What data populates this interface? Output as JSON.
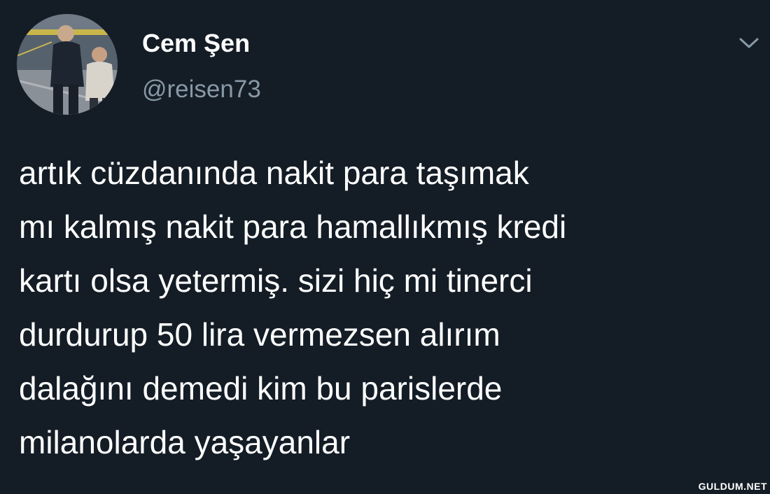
{
  "tweet": {
    "author": {
      "display_name": "Cem Şen",
      "handle": "@reisen73",
      "avatar": "profile-photo"
    },
    "menu_icon": "chevron-down-icon",
    "text": "artık cüzdanında nakit para taşımak\nmı kalmış nakit para hamallıkmış kredi\nkartı olsa yetermiş. sizi hiç mi tinerci\ndurdurup 50 lira vermezsen alırım\ndalağını demedi kim bu parislerde\nmilanolarda yaşayanlar"
  },
  "watermark": {
    "text": "GULDUM.NET"
  },
  "colors": {
    "background": "#141d26",
    "primary_text": "#ffffff",
    "secondary_text": "#8899a6"
  }
}
